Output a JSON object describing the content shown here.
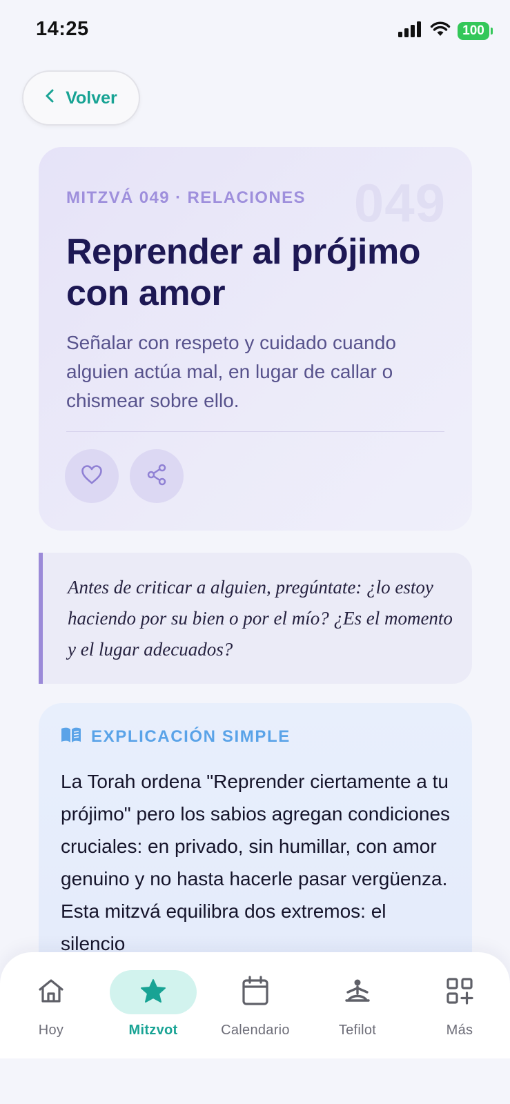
{
  "status_bar": {
    "time": "14:25",
    "battery": "100"
  },
  "header": {
    "back_label": "Volver"
  },
  "hero": {
    "kicker": "MITZVÁ 049 · RELACIONES",
    "number": "049",
    "title": "Reprender al prójimo con amor",
    "description": "Señalar con respeto y cuidado cuando alguien actúa mal, en lugar de callar o chismear sobre ello."
  },
  "quote": {
    "text": "Antes de criticar a alguien, pregúntate: ¿lo estoy haciendo por su bien o por el mío? ¿Es el momento y el lugar adecuados?"
  },
  "explanation": {
    "title": "EXPLICACIÓN SIMPLE",
    "body": "La Torah ordena \"Reprender ciertamente a tu prójimo\" pero los sabios agregan condiciones cruciales: en privado, sin humillar, con amor genuino y no hasta hacerle pasar vergüenza. Esta mitzvá equilibra dos extremos: el silencio"
  },
  "nav": {
    "items": [
      {
        "label": "Hoy",
        "icon": "home-icon"
      },
      {
        "label": "Mitzvot",
        "icon": "star-icon",
        "active": true
      },
      {
        "label": "Calendario",
        "icon": "calendar-icon"
      },
      {
        "label": "Tefilot",
        "icon": "prayer-icon"
      },
      {
        "label": "Más",
        "icon": "grid-plus-icon"
      }
    ]
  },
  "colors": {
    "accent": "#18a394",
    "hero_bg": "#e6e3f8",
    "kicker": "#9e8fdc",
    "quote_border": "#9b8ad8",
    "explain_accent": "#5aa3e8",
    "nav_active_bg": "#d2f3ee"
  }
}
